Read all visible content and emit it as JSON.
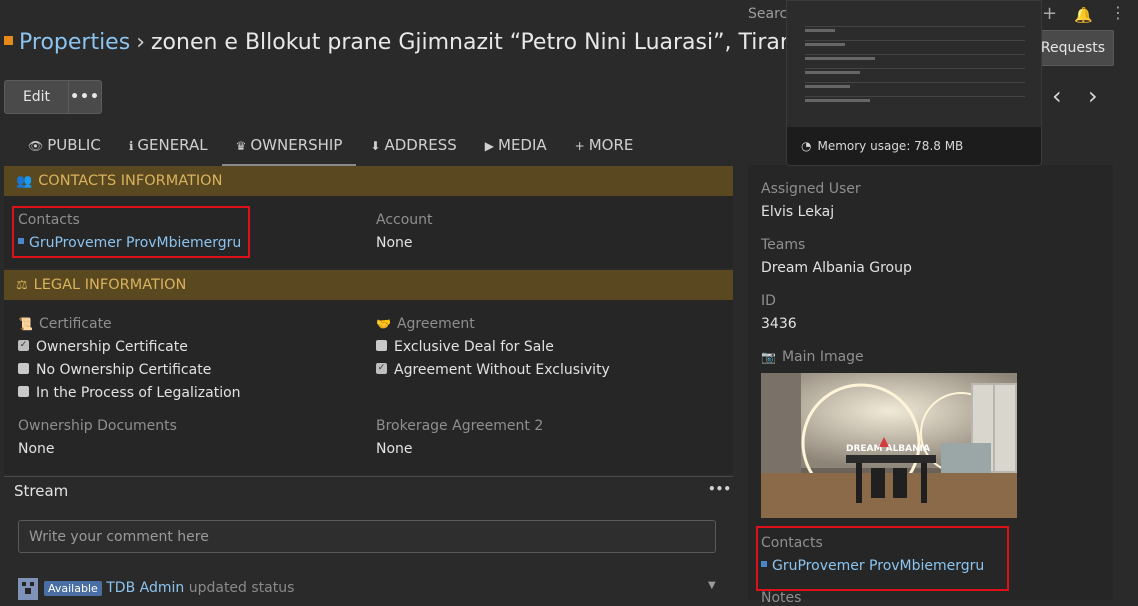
{
  "breadcrumb": {
    "section": "Properties",
    "separator": "›",
    "record_name": "zonen e Bllokut prane Gjimnazit “Petro Nini Luarasi”, Tirane"
  },
  "topbar": {
    "search_label": "Search",
    "requests_label": "Requests"
  },
  "actions": {
    "edit_label": "Edit",
    "more_label": "•••"
  },
  "tabs": [
    {
      "icon": "👁",
      "label": "PUBLIC"
    },
    {
      "icon": "ℹ",
      "label": "GENERAL"
    },
    {
      "icon": "♛",
      "label": "OWNERSHIP"
    },
    {
      "icon": "⬇",
      "label": "ADDRESS"
    },
    {
      "icon": "▶",
      "label": "MEDIA"
    },
    {
      "icon": "+",
      "label": "MORE"
    }
  ],
  "contacts_panel": {
    "title": "CONTACTS INFORMATION",
    "contacts_label": "Contacts",
    "contacts_value": "GruProvemer ProvMbiemergru",
    "account_label": "Account",
    "account_value": "None"
  },
  "legal_panel": {
    "title": "LEGAL INFORMATION",
    "certificate_label": "Certificate",
    "certificates": [
      {
        "label": "Ownership Certificate",
        "checked": true
      },
      {
        "label": "No Ownership Certificate",
        "checked": false
      },
      {
        "label": "In the Process of Legalization",
        "checked": false
      }
    ],
    "agreement_label": "Agreement",
    "agreements": [
      {
        "label": "Exclusive Deal for Sale",
        "checked": false
      },
      {
        "label": "Agreement Without Exclusivity",
        "checked": true
      }
    ],
    "ownership_docs_label": "Ownership Documents",
    "ownership_docs_value": "None",
    "brokerage_label": "Brokerage Agreement 2",
    "brokerage_value": "None"
  },
  "stream": {
    "title": "Stream",
    "menu": "•••",
    "comment_placeholder": "Write your comment here",
    "entry_badge": "Available",
    "entry_user": "TDB Admin",
    "entry_action": "updated status"
  },
  "side": {
    "assigned_user_label": "Assigned User",
    "assigned_user_value": "Elvis Lekaj",
    "teams_label": "Teams",
    "teams_value": "Dream Albania Group",
    "id_label": "ID",
    "id_value": "3436",
    "main_image_label": "Main Image",
    "image_brand": "DREAM ALBANIA",
    "contacts_label": "Contacts",
    "contacts_value": "GruProvemer ProvMbiemergru",
    "notes_label": "Notes"
  },
  "overlay": {
    "memory_usage": "Memory usage: 78.8 MB"
  }
}
